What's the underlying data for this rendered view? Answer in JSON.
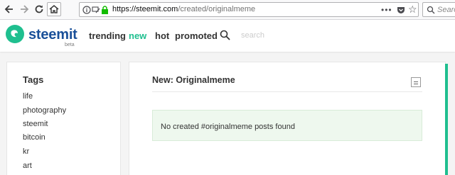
{
  "browser": {
    "url_host": "https://steemit.com",
    "url_path": "/created/originalmeme",
    "search_placeholder": "Search"
  },
  "header": {
    "brand": "steemit",
    "beta": "beta",
    "nav": [
      {
        "label": "trending",
        "active": false
      },
      {
        "label": "new",
        "active": true
      },
      {
        "label": "hot",
        "active": false
      },
      {
        "label": "promoted",
        "active": false
      }
    ],
    "search_placeholder": "search"
  },
  "sidebar": {
    "title": "Tags",
    "tags": [
      "life",
      "photography",
      "steemit",
      "bitcoin",
      "kr",
      "art"
    ]
  },
  "main": {
    "title": "New: Originalmeme",
    "empty_message": "No created #originalmeme posts found"
  },
  "colors": {
    "accent_green": "#1fbf8f",
    "brand_blue": "#1a5099"
  },
  "icons": {
    "back": "arrow-left-icon",
    "forward": "arrow-right-icon",
    "reload": "reload-icon",
    "home": "home-icon",
    "secure": "lock-icon",
    "more": "ellipsis-icon",
    "pocket": "pocket-icon",
    "bookmark": "star-icon",
    "search": "search-icon"
  }
}
